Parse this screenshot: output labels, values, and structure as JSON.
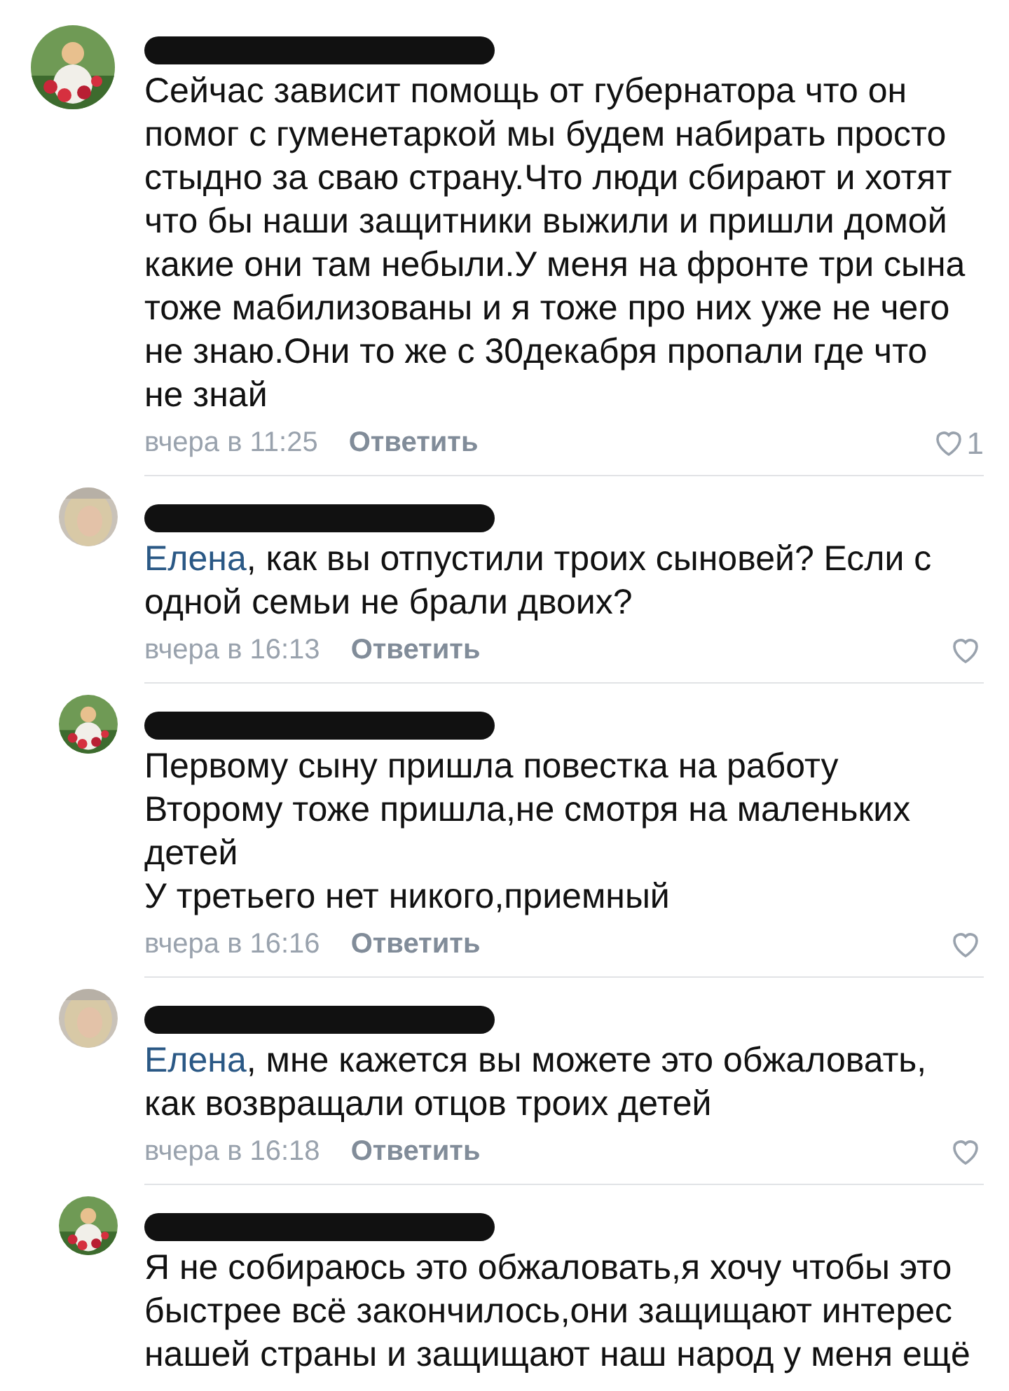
{
  "comments": [
    {
      "text": "Сейчас зависит помощь от губернатора что он\nпомог с гуменетаркой мы будем набирать просто\nстыдно за сваю страну.Что люди сбирают и хотят\nчто бы наши защитники выжили и пришли домой\nкакие они там небыли.У меня на фронте три сына\nтоже мабилизованы и я тоже про них уже не чего\nне знаю.Они то же с 30декабря пропали где что\nне знай",
      "time": "вчера в 11:25",
      "reply": "Ответить",
      "likes": "1"
    },
    {
      "reply_to": "Елена",
      "text": ", как вы отпустили троих сыновей? Если с\nодной семьи не брали двоих?",
      "time": "вчера в 16:13",
      "reply": "Ответить"
    },
    {
      "text": "Первому сыну пришла повестка на работу\nВторому тоже пришла,не смотря на маленьких\nдетей\nУ третьего нет никого,приемный",
      "time": "вчера в 16:16",
      "reply": "Ответить"
    },
    {
      "reply_to": "Елена",
      "text": ", мне кажется вы можете это обжаловать,\nкак возвращали отцов троих детей",
      "time": "вчера в 16:18",
      "reply": "Ответить"
    },
    {
      "text": "Я не собираюсь это обжаловать,я хочу чтобы это\nбыстрее всё закончилось,они защищают интерес\nнашей страны и защищают наш народ у меня ещё"
    }
  ]
}
